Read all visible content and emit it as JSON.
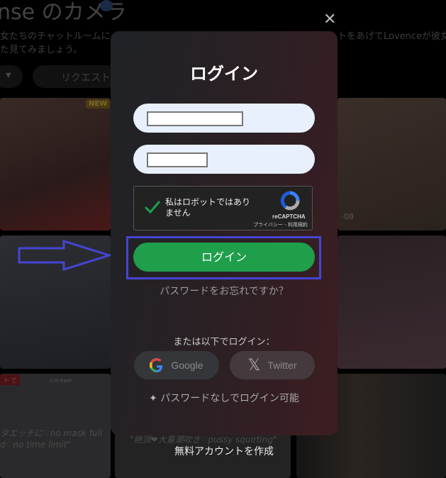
{
  "background": {
    "heading": "nse のカメラ",
    "desc_line1_left": "女たちのチャットルームに",
    "desc_line1_right": "トをあげてLovenceが彼女た",
    "desc_line2": "た見てみましょう。",
    "request_chip": "リクエスト",
    "new_badge": "NEW",
    "tile_label": "-08",
    "tile_badge": "トで",
    "crit_rate": "Crit Rate",
    "caption1_line1": "タエッチに♡no mask full",
    "caption1_line2": "d♡no time limit\"",
    "caption2": "\"絶頂❤大量潮吹き♡pussy squirting\""
  },
  "modal": {
    "title": "ログイン",
    "close_icon": "close-icon",
    "captcha": {
      "label": "私はロボットではありません",
      "brand": "reCAPTCHA",
      "links": "プライバシー - 利用規約"
    },
    "login_button": "ログイン",
    "forgot_password": "パスワードをお忘れですか？",
    "or_login_with": "または以下でログイン：",
    "google": "Google",
    "twitter": "Twitter",
    "passwordless": "パスワードなしでログイン可能"
  },
  "create_account": "無料アカウントを作成",
  "colors": {
    "accent_green": "#1f9e4b",
    "annotation_blue": "#4040d0",
    "input_bg": "#e8f0fe"
  }
}
